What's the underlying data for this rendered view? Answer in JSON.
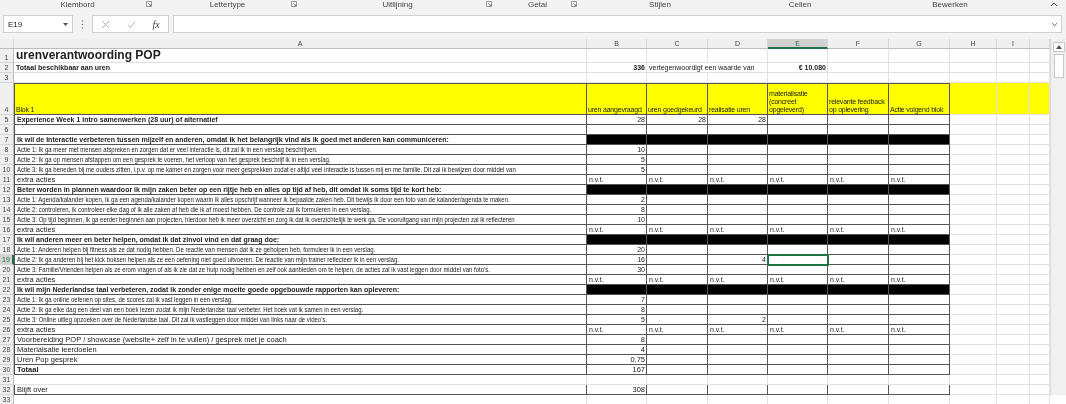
{
  "ribbon_groups": [
    {
      "label": "Klembord",
      "launcher": true
    },
    {
      "label": "Lettertype",
      "launcher": true
    },
    {
      "label": "Uitlijning",
      "launcher": true
    },
    {
      "label": "Getal",
      "launcher": true
    },
    {
      "label": "Stijlen",
      "launcher": false
    },
    {
      "label": "Cellen",
      "launcher": false
    },
    {
      "label": "Bewerken",
      "launcher": false
    }
  ],
  "formula_bar": {
    "name_box": "E19",
    "function_label": "fx"
  },
  "columns": [
    {
      "label": "A",
      "selected": false
    },
    {
      "label": "B",
      "selected": false
    },
    {
      "label": "C",
      "selected": false
    },
    {
      "label": "D",
      "selected": false
    },
    {
      "label": "E",
      "selected": true
    },
    {
      "label": "F",
      "selected": false
    },
    {
      "label": "G",
      "selected": false
    },
    {
      "label": "H",
      "selected": false
    },
    {
      "label": "I",
      "selected": false
    }
  ],
  "rows": [
    {
      "number": "1",
      "kind": "title",
      "selected": false,
      "cells": {
        "a": {
          "kind": "strong-text",
          "text": "urenverantwoording POP"
        }
      }
    },
    {
      "number": "2",
      "kind": "info",
      "selected": false,
      "cells": {
        "a": {
          "kind": "strong-text",
          "text": "Totaal beschikbaar aan uren"
        },
        "b": {
          "kind": "strong-number",
          "text": "336"
        },
        "c": {
          "kind": "text",
          "text": "vertegenwoordigt een waarde van"
        },
        "e": {
          "kind": "strong-number",
          "text": "€ 10.080"
        }
      }
    },
    {
      "number": "3",
      "kind": "blank",
      "selected": false,
      "cells": {}
    },
    {
      "number": "4",
      "kind": "header",
      "selected": false,
      "cells": {
        "a": {
          "kind": "text",
          "text": "Blok 1"
        },
        "b": {
          "kind": "text",
          "text": "uren aangevraagd"
        },
        "c": {
          "kind": "text",
          "text": "uren goedgekeurd"
        },
        "d": {
          "kind": "text",
          "text": "realisatie uren"
        },
        "e": {
          "kind": "text",
          "text": "materialisatie (concreet opgeleverd)"
        },
        "f": {
          "kind": "text",
          "text": "relevante feedback op oplevering"
        },
        "g": {
          "kind": "text",
          "text": "Actie volgend blok"
        }
      }
    },
    {
      "number": "5",
      "kind": "section",
      "selected": false,
      "cells": {
        "a": {
          "kind": "strong-text",
          "text": "Experience Week 1 intro samenwerken (28 uur) of alternatief"
        },
        "b": {
          "kind": "number",
          "text": "28"
        },
        "c": {
          "kind": "number",
          "text": "28"
        },
        "d": {
          "kind": "number",
          "text": "28"
        }
      }
    },
    {
      "number": "6",
      "kind": "spacer",
      "selected": false,
      "cells": {}
    },
    {
      "number": "7",
      "kind": "goal",
      "selected": false,
      "cells": {
        "a": {
          "kind": "strong-text",
          "text": "Ik wil de Interactie verbeteren tussen mijzelf en anderen, omdat ik het belangrijk vind als ik goed met anderen kan communiceren:"
        }
      }
    },
    {
      "number": "8",
      "kind": "action",
      "selected": false,
      "cells": {
        "a": {
          "kind": "text",
          "text": "Actie 1: Ik ga meer met mensen afspreken en zorgen dat er veel interactie is, dit zal ik in een verslag beschrijven."
        },
        "b": {
          "kind": "number",
          "text": "10"
        }
      }
    },
    {
      "number": "9",
      "kind": "action",
      "selected": false,
      "cells": {
        "a": {
          "kind": "text",
          "text": "Actie 2: Ik ga op mensen afstappen om een gesprek te voeren, het verloop van het gesprek beschrijf ik in een verslag."
        },
        "b": {
          "kind": "number",
          "text": "5"
        }
      }
    },
    {
      "number": "10",
      "kind": "action",
      "selected": false,
      "cells": {
        "a": {
          "kind": "text",
          "text": "Actie 3: Ik ga beneden bij me ouders zitten, i.p.v. op me kamer en zorgen voor meer gesprekken zodat er altijd veel interactie is tussen mij en me familie. Dit zal ik bewijzen door middel van"
        },
        "b": {
          "kind": "number",
          "text": "5"
        }
      }
    },
    {
      "number": "11",
      "kind": "extra",
      "selected": false,
      "cells": {
        "a": {
          "kind": "text",
          "text": "extra acties"
        },
        "b": {
          "kind": "text",
          "text": "n.v.t."
        },
        "c": {
          "kind": "text",
          "text": "n.v.t."
        },
        "d": {
          "kind": "text",
          "text": "n.v.t."
        },
        "e": {
          "kind": "text",
          "text": "n.v.t."
        },
        "f": {
          "kind": "text",
          "text": "n.v.t."
        },
        "g": {
          "kind": "text",
          "text": "n.v.t."
        }
      }
    },
    {
      "number": "12",
      "kind": "goal",
      "selected": false,
      "cells": {
        "a": {
          "kind": "strong-text",
          "text": "Beter worden in plannen waardoor ik mijn zaken beter op een rijtje heb en alles op tijd af heb, dit omdat ik soms tijd te kort heb:"
        }
      }
    },
    {
      "number": "13",
      "kind": "action",
      "selected": false,
      "cells": {
        "a": {
          "kind": "text",
          "text": "Actie 1: Agenda/kalander kopen, ik ga een agenda/kalander kopen waarin ik alles opschrijf wanneer ik bepaalde zaken heb. Dit bewijs ik door een foto van de kalander/agenda te maken."
        },
        "b": {
          "kind": "number",
          "text": "2"
        }
      }
    },
    {
      "number": "14",
      "kind": "action",
      "selected": false,
      "cells": {
        "a": {
          "kind": "text",
          "text": "Actie 2: controleren, ik controleer elke dag of ik alle zaken af heb die ik af moest hebben. De controle zal ik formuleren in een verslag."
        },
        "b": {
          "kind": "number",
          "text": "8"
        }
      }
    },
    {
      "number": "15",
      "kind": "action",
      "selected": false,
      "cells": {
        "a": {
          "kind": "text",
          "text": "Actie 3: Op tijd beginnen, ik ga eerder beginnen aan projecten, hierdoor heb ik meer overzicht en zorg ik dat ik overzichtelijk te werk ga. De vooruitgang van mijn projecten zal ik reflecteren"
        },
        "b": {
          "kind": "number",
          "text": "10"
        }
      }
    },
    {
      "number": "16",
      "kind": "extra",
      "selected": false,
      "cells": {
        "a": {
          "kind": "text",
          "text": "extra acties"
        },
        "b": {
          "kind": "text",
          "text": "n.v.t."
        },
        "c": {
          "kind": "text",
          "text": "n.v.t."
        },
        "d": {
          "kind": "text",
          "text": "n.v.t."
        },
        "e": {
          "kind": "text",
          "text": "n.v.t."
        },
        "f": {
          "kind": "text",
          "text": "n.v.t."
        },
        "g": {
          "kind": "text",
          "text": "n.v.t."
        }
      }
    },
    {
      "number": "17",
      "kind": "goal",
      "selected": false,
      "cells": {
        "a": {
          "kind": "strong-text",
          "text": "Ik wil anderen meer en beter helpen, omdat ik dat zinvol vind en dat graag doe:"
        }
      }
    },
    {
      "number": "18",
      "kind": "action",
      "selected": false,
      "cells": {
        "a": {
          "kind": "text",
          "text": "Actie 1: Anderen helpen bij fitness als ze dat nodig hebben. De reactie van mensen dat ik ze geholpen heb, formuleer ik in een verslag."
        },
        "b": {
          "kind": "number",
          "text": "20"
        }
      }
    },
    {
      "number": "19",
      "kind": "action",
      "selected": true,
      "cells": {
        "a": {
          "kind": "text",
          "text": "Actie 2: Ik ga anderen bij het kick boksen helpen als ze een oefening niet goed uitvoeren. De reactie van mijn trainer reflecteer ik in een verslag."
        },
        "b": {
          "kind": "number",
          "text": "16"
        },
        "d": {
          "kind": "number",
          "text": "4"
        }
      }
    },
    {
      "number": "20",
      "kind": "action",
      "selected": false,
      "cells": {
        "a": {
          "kind": "text",
          "text": "Actie 3: Familie/Vrienden helpen als ze erom vragen of als ik zie dat ze hulp nodig hebben en zelf ook aanbieden om te helpen, de acties zal ik vast leggen door middel van foto’s."
        },
        "b": {
          "kind": "number",
          "text": "30"
        }
      }
    },
    {
      "number": "21",
      "kind": "extra",
      "selected": false,
      "cells": {
        "a": {
          "kind": "text",
          "text": "extra acties"
        },
        "b": {
          "kind": "text",
          "text": "n.v.t."
        },
        "c": {
          "kind": "text",
          "text": "n.v.t."
        },
        "d": {
          "kind": "text",
          "text": "n.v.t."
        },
        "e": {
          "kind": "text",
          "text": "n.v.t."
        },
        "f": {
          "kind": "text",
          "text": "n.v.t."
        },
        "g": {
          "kind": "text",
          "text": "n.v.t."
        }
      }
    },
    {
      "number": "22",
      "kind": "goal",
      "selected": false,
      "cells": {
        "a": {
          "kind": "strong-text",
          "text": "Ik wil mijn Nederlandse taal verbeteren, zodat ik zonder enige moeite goede opgebouwde rapporten kan opleveren:"
        }
      }
    },
    {
      "number": "23",
      "kind": "action",
      "selected": false,
      "cells": {
        "a": {
          "kind": "text",
          "text": "Actie 1: Ik ga online oefenen op sites, de scores zal ik vast leggen in een verslag."
        },
        "b": {
          "kind": "number",
          "text": "7"
        }
      }
    },
    {
      "number": "24",
      "kind": "action",
      "selected": false,
      "cells": {
        "a": {
          "kind": "text",
          "text": "Actie 2: Ik ga elke dag een deel van een boek lezen zodat ik mijn Nederlandse taal verbeter. Het boek vat ik samen in een verslag."
        },
        "b": {
          "kind": "number",
          "text": "8"
        }
      }
    },
    {
      "number": "25",
      "kind": "action",
      "selected": false,
      "cells": {
        "a": {
          "kind": "text",
          "text": "Actie 3: Online uitleg opzoeken over de Nederlandse taal. Dit zal ik vastleggen door middel van links naar de video’s."
        },
        "b": {
          "kind": "number",
          "text": "5"
        },
        "d": {
          "kind": "number",
          "text": "2"
        }
      }
    },
    {
      "number": "26",
      "kind": "extra",
      "selected": false,
      "cells": {
        "a": {
          "kind": "text",
          "text": "extra acties"
        },
        "b": {
          "kind": "text",
          "text": "n.v.t."
        },
        "c": {
          "kind": "text",
          "text": "n.v.t."
        },
        "d": {
          "kind": "text",
          "text": "n.v.t."
        },
        "e": {
          "kind": "text",
          "text": "n.v.t."
        },
        "f": {
          "kind": "text",
          "text": "n.v.t."
        },
        "g": {
          "kind": "text",
          "text": "n.v.t."
        }
      }
    },
    {
      "number": "27",
      "kind": "item",
      "selected": false,
      "cells": {
        "a": {
          "kind": "text",
          "text": "Voorbereiding POP /  showcase (website+ zelf in te vullen) / gesprek met je coach"
        },
        "b": {
          "kind": "number",
          "text": "8"
        }
      }
    },
    {
      "number": "28",
      "kind": "item",
      "selected": false,
      "cells": {
        "a": {
          "kind": "text",
          "text": "Materialsatie leerdoelen"
        },
        "b": {
          "kind": "number",
          "text": "4"
        }
      }
    },
    {
      "number": "29",
      "kind": "item",
      "selected": false,
      "cells": {
        "a": {
          "kind": "text",
          "text": "Uren Pop gesprek"
        },
        "b": {
          "kind": "number",
          "text": "0,75"
        }
      }
    },
    {
      "number": "30",
      "kind": "item",
      "selected": false,
      "cells": {
        "a": {
          "kind": "strong-text",
          "text": "Totaal"
        },
        "b": {
          "kind": "number",
          "text": "167"
        }
      }
    },
    {
      "number": "31",
      "kind": "blank",
      "selected": false,
      "cells": {}
    },
    {
      "number": "32",
      "kind": "item",
      "selected": false,
      "cells": {
        "a": {
          "kind": "text",
          "text": "Blijft over"
        },
        "b": {
          "kind": "number",
          "text": "308"
        }
      }
    },
    {
      "number": "33",
      "kind": "blank",
      "selected": false,
      "cells": {}
    }
  ]
}
